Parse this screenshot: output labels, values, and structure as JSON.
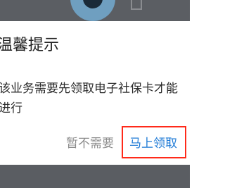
{
  "dialog": {
    "title": "温馨提示",
    "message": "该业务需要先领取电子社保卡才能进行",
    "cancel_label": "暂不需要",
    "confirm_label": "马上领取"
  },
  "colors": {
    "overlay": "#55585e",
    "dialog_bg": "#ffffff",
    "cancel_text": "#8c8c8c",
    "confirm_text": "#1e7ad6",
    "highlight_frame": "#ff2a1a"
  }
}
